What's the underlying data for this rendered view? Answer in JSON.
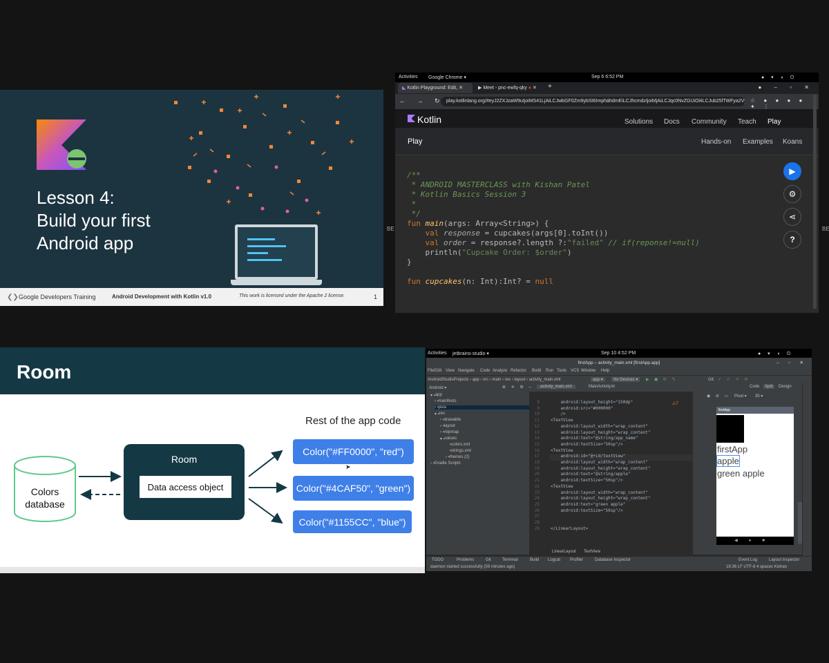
{
  "slide1": {
    "title": "Lesson 4:\nBuild your first\nAndroid app",
    "footer_brand": "Google Developers Training",
    "footer_course": "Android Development with Kotlin v1.0",
    "footer_license": "This work is licensed under the Apache 2 license.",
    "footer_page": "1",
    "accent": "#f3863a"
  },
  "chrome": {
    "activities": "Activities",
    "app_name": "Google Chrome ▾",
    "clock": "Sep 6  6:52 PM",
    "tab1": "Kotlin Playground: Edit,",
    "tab2": "Meet - pnc-ewfq-qky",
    "url": "play.kotlinlang.org/#eyJ2ZXJzaW9uIjoiMS41LjAiLCJwbGF0Zm9ybSI6ImpháhdmEiLCJhcmdzIjoiMjAiLCJqc0NvZGUiOiIiLCJub25lTWFya2VycyI6dH...",
    "brand": "Kotlin",
    "nav": [
      "Solutions",
      "Docs",
      "Community",
      "Teach",
      "Play"
    ],
    "subtitle": "Play",
    "subnav": [
      "Hands-on",
      "Examples",
      "Koans"
    ],
    "code": {
      "c1": "/**",
      "c2": " * ANDROID MASTERCLASS with Kishan Patel",
      "c3": " * Kotlin Basics Session 3",
      "c4": " *",
      "c5": " */",
      "l1_kw": "fun",
      "l1_fn": "main",
      "l1_rest": "(args: Array<String>) {",
      "l2_kw": "val",
      "l2_it": "response",
      "l2_rest": " = cupcakes(args[0].toInt())",
      "l3_kw": "val",
      "l3_it": "order",
      "l3_rest": " = response?.length ?:",
      "l3_str": "\"failed\"",
      "l3_com": " // if(reponse!=null)",
      "l4_a": "println(",
      "l4_str": "\"Cupcake Order: $order\"",
      "l4_b": ")",
      "l5": "}",
      "l6_kw": "fun",
      "l6_fn": "cupcakes",
      "l6_rest": "(n: Int):Int? =",
      "l6_null": "null"
    },
    "side_label": "BE"
  },
  "room": {
    "title": "Room",
    "rest_label": "Rest of the app code",
    "db_label": "Colors\ndatabase",
    "room_label": "Room",
    "dao_label": "Data access object",
    "colors": [
      "Color(\"#FF0000\", \"red\")",
      "Color(\"#4CAF50\", \"green\")",
      "Color(\"#1155CC\", \"blue\")"
    ]
  },
  "studio": {
    "activities": "Activities",
    "app_name": "jetbrains-studio ▾",
    "clock": "Sep 10  4:52 PM",
    "window_title": "firstApp – activity_main.xml [firstApp.app]",
    "menu": [
      "File",
      "Edit",
      "View",
      "Navigate",
      "Code",
      "Analyze",
      "Refactor",
      "Build",
      "Run",
      "Tools",
      "VCS",
      "Window",
      "Help"
    ],
    "breadcrumb": "AndroidStudioProjects › app › src › main › res › layout › activity_main.xml",
    "run_config": "app ▾",
    "devices": "No Devices ▾",
    "git": "Git:",
    "project_view": "Android ▾",
    "editor_tabs": [
      "activity_main.xml",
      "MainActivity.kt"
    ],
    "view_modes": [
      "Code",
      "Split",
      "Design"
    ],
    "tree": [
      "app",
      "manifests",
      "java",
      "res",
      "drawable",
      "layout",
      "mipmap",
      "values",
      "colors.xml",
      "strings.xml",
      "themes (2)",
      "Gradle Scripts"
    ],
    "line_numbers": "8\n9\n10\n11\n12\n13\n14\n15\n16\n17\n18\n19\n20\n21\n22\n23\n24\n25\n26\n27\n28\n29",
    "xml": "    android:layout_height=\"150dp\"\n    android:src=\"#000000\"\n    />\n<TextView\n    android:layout_width=\"wrap_content\"\n    android:layout_height=\"wrap_content\"\n    android:text=\"@string/app_name\"\n    android:textSize=\"50sp\"/>\n<TextView\n    android:id=\"@+id/textView\"\n    android:layout_width=\"wrap_content\"\n    android:layout_height=\"wrap_content\"\n    android:text=\"@string/apple\"\n    android:textSize=\"50sp\"/>\n<TextView\n    android:layout_width=\"wrap_content\"\n    android:layout_height=\"wrap_content\"\n    android:text=\"green apple\"\n    android:textSize=\"50sp\"/>\n\n\n</LinearLayout>",
    "warning": "⚠7",
    "preview_device": "Pixel ▾",
    "preview_api": "30 ▾",
    "preview_appbar": "firstApp",
    "preview_texts": [
      "firstApp",
      "apple",
      "green apple"
    ],
    "bottom_breadcrumb": [
      "LinearLayout",
      "TextView"
    ],
    "tool_tabs": [
      "TODO",
      "Problems",
      "Git",
      "Terminal",
      "Build",
      "Logcat",
      "Profiler",
      "Database Inspector"
    ],
    "right_tools": [
      "Event Log",
      "Layout Inspector"
    ],
    "status_msg": "daemon started successfully (59 minutes ago)",
    "status_right": "18:36   LF   UTF-8   4 spaces   Kishan"
  }
}
